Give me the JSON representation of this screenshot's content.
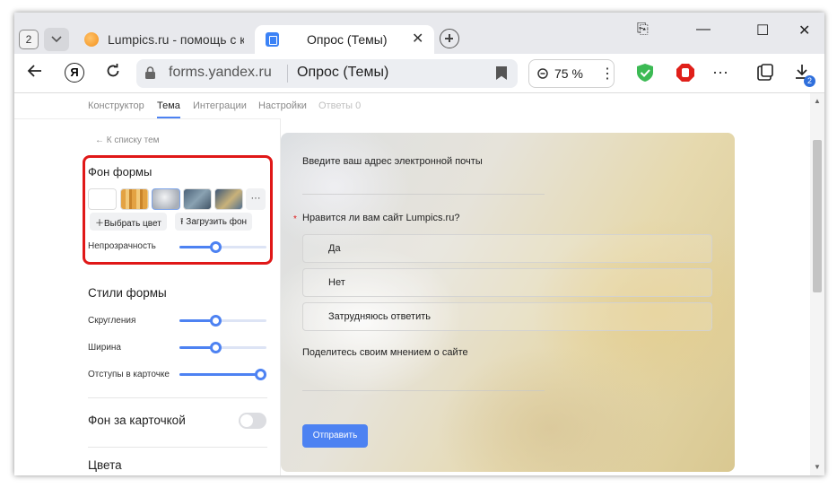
{
  "browser": {
    "tab_count": "2",
    "tabs": [
      {
        "title": "Lumpics.ru - помощь с компьютером"
      },
      {
        "title": "Опрос (Темы)",
        "close": "✕"
      }
    ],
    "window_controls": {
      "bookmark": "⎘",
      "minimize": "—",
      "maximize": "☐",
      "close": "✕"
    },
    "address": {
      "domain": "forms.yandex.ru",
      "page_title": "Опрос (Темы)"
    },
    "zoom": "75 %",
    "downloads_badge": "2",
    "colors": {
      "accent": "#4d82f2",
      "highlight": "#e01818"
    }
  },
  "editor": {
    "tabs": [
      "Конструктор",
      "Тема",
      "Интеграции",
      "Настройки",
      "Ответы  0"
    ],
    "active_tab": "Тема",
    "back_link": "← К списку тем",
    "form_background": {
      "title": "Фон формы",
      "more": "···",
      "pick_color": "Выбрать цвет",
      "upload_bg": "Загрузить фон",
      "opacity_label": "Непрозрачность",
      "opacity": 0.4
    },
    "form_styles": {
      "title": "Стили формы",
      "rounding_label": "Скругления",
      "rounding": 0.4,
      "width_label": "Ширина",
      "width": 0.4,
      "padding_label": "Отступы в карточке",
      "padding": 1.0
    },
    "card_bg": {
      "title": "Фон за карточкой",
      "enabled": false
    },
    "colors_title": "Цвета"
  },
  "preview": {
    "q1": "Введите ваш адрес электронной почты",
    "q2": "Нравится ли вам сайт Lumpics.ru?",
    "q2_required": "*",
    "options": [
      "Да",
      "Нет",
      "Затрудняюсь ответить"
    ],
    "q3": "Поделитесь своим мнением о сайте",
    "submit": "Отправить"
  }
}
